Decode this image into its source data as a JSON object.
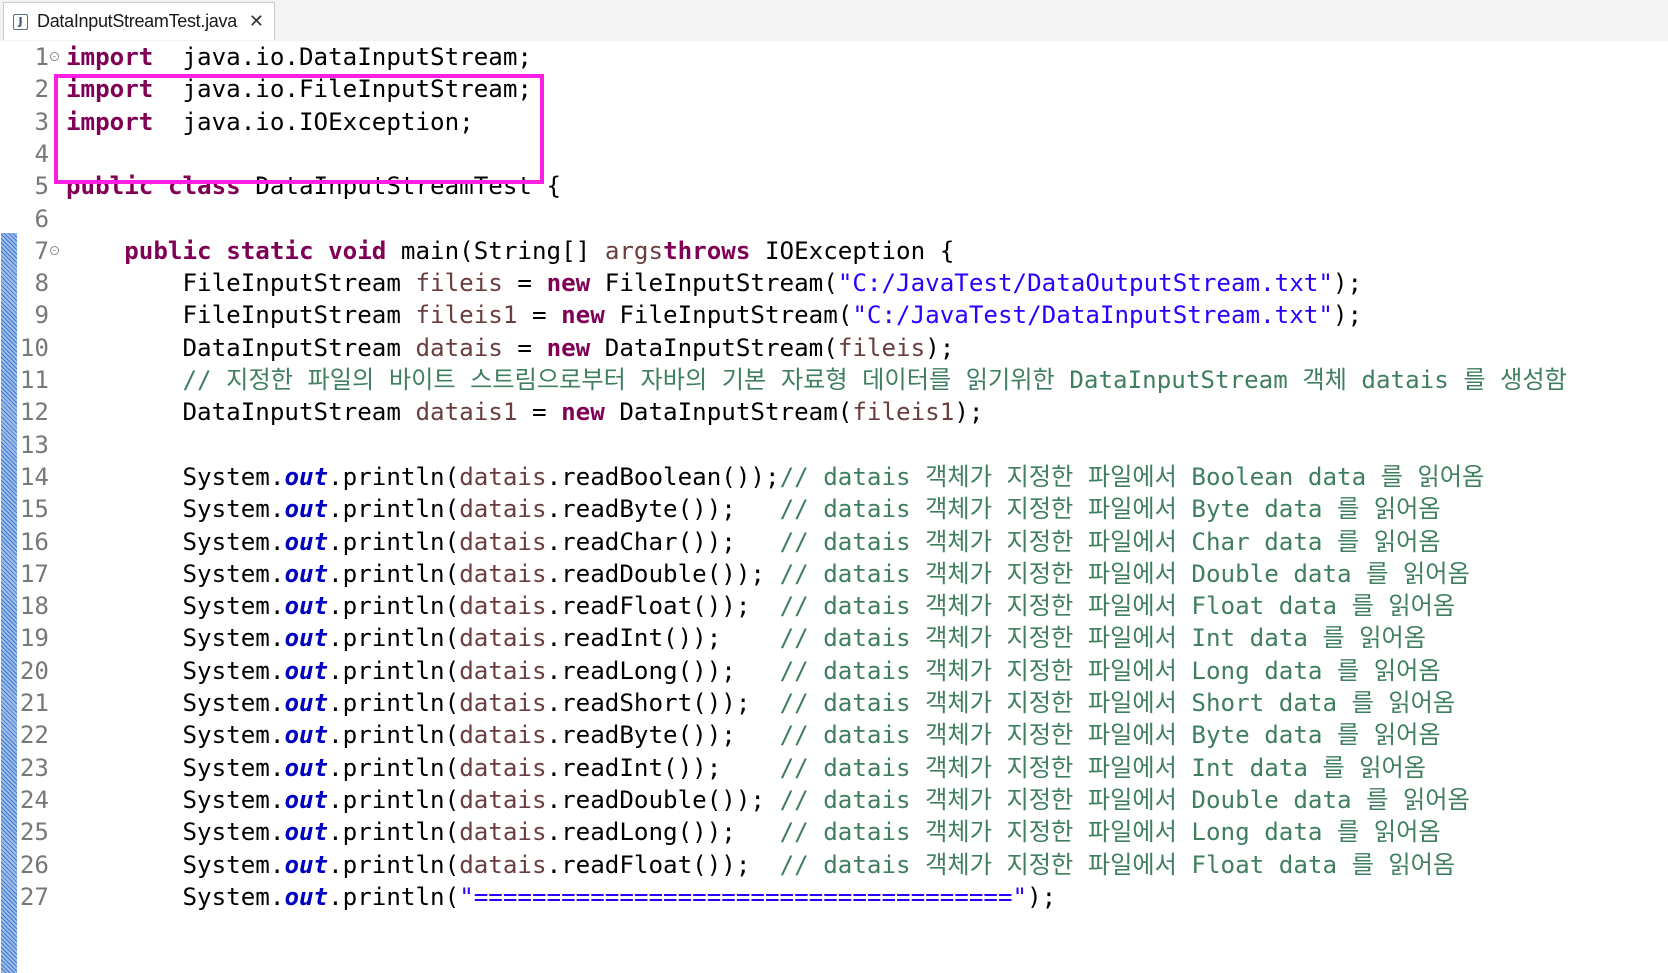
{
  "tab": {
    "title": "DataInputStreamTest.java",
    "icon_letter": "J",
    "close_glyph": "✕"
  },
  "colors": {
    "keyword": "#7f0055",
    "string": "#2a00ff",
    "comment": "#3f7f5f",
    "field": "#0000c0",
    "variable": "#6a3e3e",
    "highlight": "#ff1fe4"
  },
  "editor": {
    "lines": [
      {
        "n": "1",
        "fold": true,
        "tokens": [
          [
            "kw",
            "import"
          ],
          [
            "",
            "  java.io.DataInputStream;"
          ]
        ]
      },
      {
        "n": "2",
        "tokens": [
          [
            "kw",
            "import"
          ],
          [
            "",
            "  java.io.FileInputStream;"
          ]
        ]
      },
      {
        "n": "3",
        "tokens": [
          [
            "kw",
            "import"
          ],
          [
            "",
            "  java.io.IOException;"
          ]
        ]
      },
      {
        "n": "4",
        "tokens": []
      },
      {
        "n": "5",
        "tokens": [
          [
            "kw",
            "public"
          ],
          [
            "",
            " "
          ],
          [
            "kw",
            "class"
          ],
          [
            "",
            " DataInputStreamTest {"
          ]
        ]
      },
      {
        "n": "6",
        "tokens": []
      },
      {
        "n": "7",
        "fold": true,
        "tokens": [
          [
            "",
            "    "
          ],
          [
            "kw",
            "public"
          ],
          [
            "",
            " "
          ],
          [
            "kw",
            "static"
          ],
          [
            "",
            " "
          ],
          [
            "kw",
            "void"
          ],
          [
            "",
            " main(String[] "
          ],
          [
            "var",
            "args"
          ],
          [
            ") "
          ],
          [
            "kw",
            "throws"
          ],
          [
            "",
            " IOException {"
          ]
        ]
      },
      {
        "n": "8",
        "tokens": [
          [
            "",
            "        FileInputStream "
          ],
          [
            "var",
            "fileis"
          ],
          [
            "",
            " = "
          ],
          [
            "kw",
            "new"
          ],
          [
            "",
            " FileInputStream("
          ],
          [
            "str",
            "\"C:/JavaTest/DataOutputStream.txt\""
          ],
          [
            "",
            ");"
          ]
        ]
      },
      {
        "n": "9",
        "tokens": [
          [
            "",
            "        FileInputStream "
          ],
          [
            "var",
            "fileis1"
          ],
          [
            "",
            " = "
          ],
          [
            "kw",
            "new"
          ],
          [
            "",
            " FileInputStream("
          ],
          [
            "str",
            "\"C:/JavaTest/DataInputStream.txt\""
          ],
          [
            "",
            ");"
          ]
        ]
      },
      {
        "n": "10",
        "tokens": [
          [
            "",
            "        DataInputStream "
          ],
          [
            "var",
            "datais"
          ],
          [
            "",
            " = "
          ],
          [
            "kw",
            "new"
          ],
          [
            "",
            " DataInputStream("
          ],
          [
            "var",
            "fileis"
          ],
          [
            "",
            ");"
          ]
        ]
      },
      {
        "n": "11",
        "tokens": [
          [
            "",
            "        "
          ],
          [
            "cm",
            "// 지정한 파일의 바이트 스트림으로부터 자바의 기본 자료형 데이터를 읽기위한 DataInputStream 객체 datais 를 생성함"
          ]
        ]
      },
      {
        "n": "12",
        "tokens": [
          [
            "",
            "        DataInputStream "
          ],
          [
            "var",
            "datais1"
          ],
          [
            "",
            " = "
          ],
          [
            "kw",
            "new"
          ],
          [
            "",
            " DataInputStream("
          ],
          [
            "var",
            "fileis1"
          ],
          [
            "",
            ");"
          ]
        ]
      },
      {
        "n": "13",
        "tokens": []
      },
      {
        "n": "14",
        "tokens": [
          [
            "",
            "        System."
          ],
          [
            "fld",
            "out"
          ],
          [
            "",
            ".println("
          ],
          [
            "var",
            "datais"
          ],
          [
            "",
            ".readBoolean());"
          ],
          [
            "cm",
            "// datais 객체가 지정한 파일에서 Boolean data 를 읽어옴"
          ]
        ]
      },
      {
        "n": "15",
        "tokens": [
          [
            "",
            "        System."
          ],
          [
            "fld",
            "out"
          ],
          [
            "",
            ".println("
          ],
          [
            "var",
            "datais"
          ],
          [
            "",
            ".readByte());   "
          ],
          [
            "cm",
            "// datais 객체가 지정한 파일에서 Byte data 를 읽어옴"
          ]
        ]
      },
      {
        "n": "16",
        "tokens": [
          [
            "",
            "        System."
          ],
          [
            "fld",
            "out"
          ],
          [
            "",
            ".println("
          ],
          [
            "var",
            "datais"
          ],
          [
            "",
            ".readChar());   "
          ],
          [
            "cm",
            "// datais 객체가 지정한 파일에서 Char data 를 읽어옴"
          ]
        ]
      },
      {
        "n": "17",
        "tokens": [
          [
            "",
            "        System."
          ],
          [
            "fld",
            "out"
          ],
          [
            "",
            ".println("
          ],
          [
            "var",
            "datais"
          ],
          [
            "",
            ".readDouble()); "
          ],
          [
            "cm",
            "// datais 객체가 지정한 파일에서 Double data 를 읽어옴"
          ]
        ]
      },
      {
        "n": "18",
        "tokens": [
          [
            "",
            "        System."
          ],
          [
            "fld",
            "out"
          ],
          [
            "",
            ".println("
          ],
          [
            "var",
            "datais"
          ],
          [
            "",
            ".readFloat());  "
          ],
          [
            "cm",
            "// datais 객체가 지정한 파일에서 Float data 를 읽어옴"
          ]
        ]
      },
      {
        "n": "19",
        "tokens": [
          [
            "",
            "        System."
          ],
          [
            "fld",
            "out"
          ],
          [
            "",
            ".println("
          ],
          [
            "var",
            "datais"
          ],
          [
            "",
            ".readInt());    "
          ],
          [
            "cm",
            "// datais 객체가 지정한 파일에서 Int data 를 읽어옴"
          ]
        ]
      },
      {
        "n": "20",
        "tokens": [
          [
            "",
            "        System."
          ],
          [
            "fld",
            "out"
          ],
          [
            "",
            ".println("
          ],
          [
            "var",
            "datais"
          ],
          [
            "",
            ".readLong());   "
          ],
          [
            "cm",
            "// datais 객체가 지정한 파일에서 Long data 를 읽어옴"
          ]
        ]
      },
      {
        "n": "21",
        "tokens": [
          [
            "",
            "        System."
          ],
          [
            "fld",
            "out"
          ],
          [
            "",
            ".println("
          ],
          [
            "var",
            "datais"
          ],
          [
            "",
            ".readShort());  "
          ],
          [
            "cm",
            "// datais 객체가 지정한 파일에서 Short data 를 읽어옴"
          ]
        ]
      },
      {
        "n": "22",
        "tokens": [
          [
            "",
            "        System."
          ],
          [
            "fld",
            "out"
          ],
          [
            "",
            ".println("
          ],
          [
            "var",
            "datais"
          ],
          [
            "",
            ".readByte());   "
          ],
          [
            "cm",
            "// datais 객체가 지정한 파일에서 Byte data 를 읽어옴"
          ]
        ]
      },
      {
        "n": "23",
        "tokens": [
          [
            "",
            "        System."
          ],
          [
            "fld",
            "out"
          ],
          [
            "",
            ".println("
          ],
          [
            "var",
            "datais"
          ],
          [
            "",
            ".readInt());    "
          ],
          [
            "cm",
            "// datais 객체가 지정한 파일에서 Int data 를 읽어옴"
          ]
        ]
      },
      {
        "n": "24",
        "tokens": [
          [
            "",
            "        System."
          ],
          [
            "fld",
            "out"
          ],
          [
            "",
            ".println("
          ],
          [
            "var",
            "datais"
          ],
          [
            "",
            ".readDouble()); "
          ],
          [
            "cm",
            "// datais 객체가 지정한 파일에서 Double data 를 읽어옴"
          ]
        ]
      },
      {
        "n": "25",
        "tokens": [
          [
            "",
            "        System."
          ],
          [
            "fld",
            "out"
          ],
          [
            "",
            ".println("
          ],
          [
            "var",
            "datais"
          ],
          [
            "",
            ".readLong());   "
          ],
          [
            "cm",
            "// datais 객체가 지정한 파일에서 Long data 를 읽어옴"
          ]
        ]
      },
      {
        "n": "26",
        "tokens": [
          [
            "",
            "        System."
          ],
          [
            "fld",
            "out"
          ],
          [
            "",
            ".println("
          ],
          [
            "var",
            "datais"
          ],
          [
            "",
            ".readFloat());  "
          ],
          [
            "cm",
            "// datais 객체가 지정한 파일에서 Float data 를 읽어옴"
          ]
        ]
      },
      {
        "n": "27",
        "tokens": [
          [
            "",
            "        System."
          ],
          [
            "fld",
            "out"
          ],
          [
            "",
            ".println("
          ],
          [
            "str",
            "\"=====================================\""
          ],
          [
            "",
            ");"
          ]
        ]
      }
    ]
  }
}
